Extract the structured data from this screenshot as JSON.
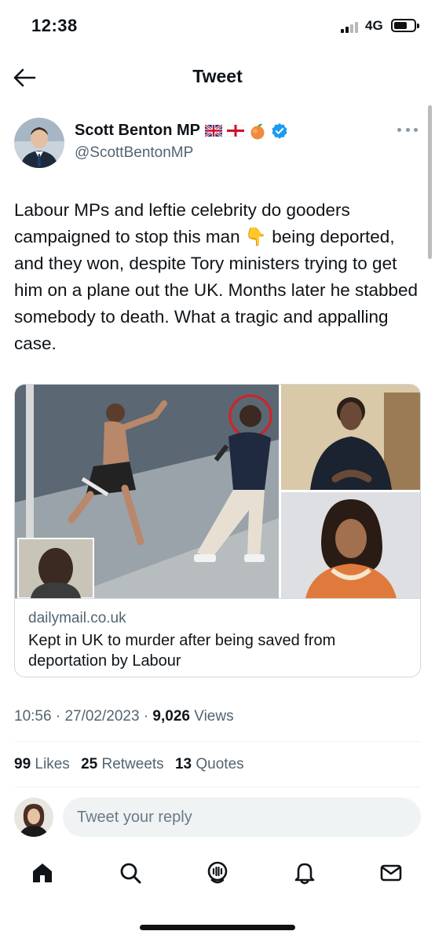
{
  "status_bar": {
    "time": "12:38",
    "network": "4G"
  },
  "header": {
    "title": "Tweet"
  },
  "author": {
    "name": "Scott Benton MP",
    "handle": "@ScottBentonMP",
    "badges": [
      "uk-flag-icon",
      "england-flag-icon",
      "peach-icon",
      "verified-icon"
    ]
  },
  "tweet": {
    "text_before_emoji": "Labour MPs and leftie celebrity do gooders campaigned to stop this man ",
    "emoji": "👇",
    "text_after_emoji": " being deported, and they won, despite Tory ministers trying to get him on a plane out the UK. Months later he stabbed somebody to death. What a tragic and appalling case."
  },
  "card": {
    "domain": "dailymail.co.uk",
    "title": "Kept in UK to murder after being saved from deportation by Labour"
  },
  "meta": {
    "time": "10:56",
    "date": "27/02/2023",
    "views_count": "9,026",
    "views_label": "Views"
  },
  "stats": {
    "likes_count": "99",
    "likes_label": "Likes",
    "retweets_count": "25",
    "retweets_label": "Retweets",
    "quotes_count": "13",
    "quotes_label": "Quotes"
  },
  "reply": {
    "placeholder": "Tweet your reply"
  },
  "tabs": [
    "home-icon",
    "search-icon",
    "spaces-icon",
    "notifications-icon",
    "messages-icon"
  ],
  "colors": {
    "verified": "#1d9bf0",
    "secondary_text": "#536471",
    "primary_text": "#0f1419"
  }
}
